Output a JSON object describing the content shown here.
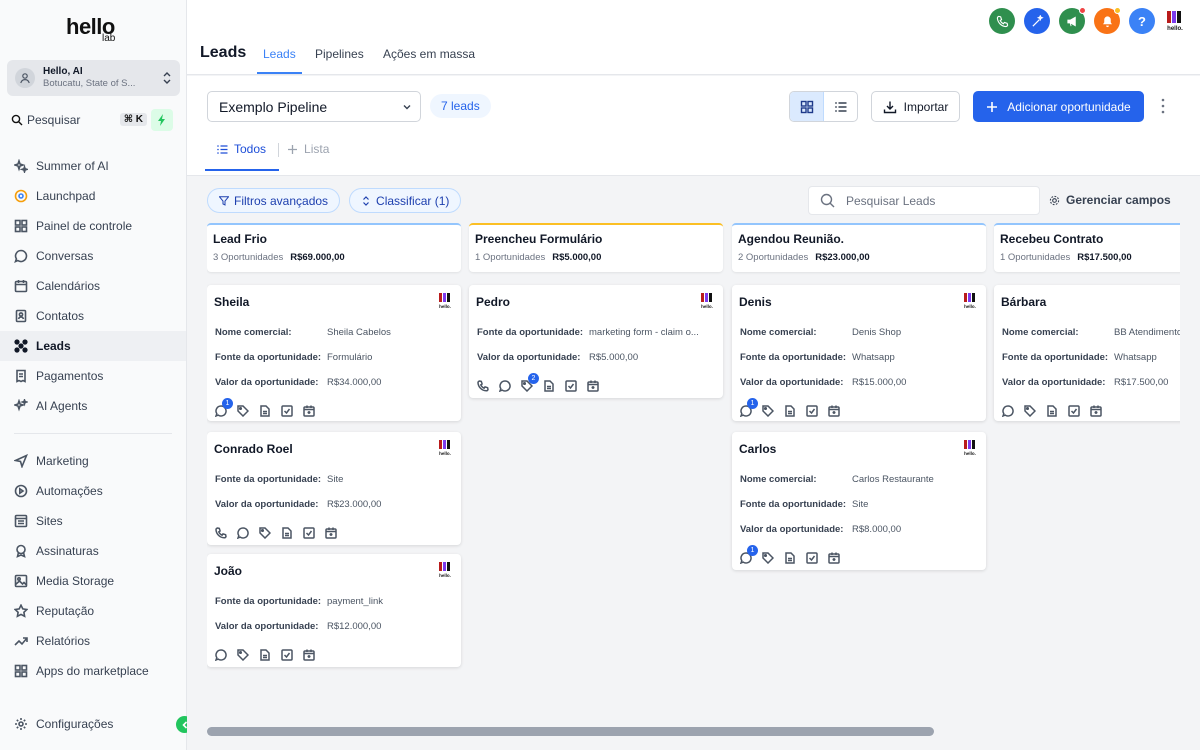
{
  "sidebar": {
    "logo": {
      "word": "hello",
      "sub": "lab"
    },
    "account": {
      "name": "Hello, AI",
      "location": "Botucatu, State of S..."
    },
    "search": {
      "label": "Pesquisar",
      "shortcut": "⌘ K"
    },
    "items": [
      {
        "label": "Summer of AI"
      },
      {
        "label": "Launchpad"
      },
      {
        "label": "Painel de controle"
      },
      {
        "label": "Conversas"
      },
      {
        "label": "Calendários"
      },
      {
        "label": "Contatos"
      },
      {
        "label": "Leads"
      },
      {
        "label": "Pagamentos"
      },
      {
        "label": "AI Agents"
      }
    ],
    "items2": [
      {
        "label": "Marketing"
      },
      {
        "label": "Automações"
      },
      {
        "label": "Sites"
      },
      {
        "label": "Assinaturas"
      },
      {
        "label": "Media Storage"
      },
      {
        "label": "Reputação"
      },
      {
        "label": "Relatórios"
      },
      {
        "label": "Apps do marketplace"
      }
    ],
    "settings": {
      "label": "Configurações"
    }
  },
  "header": {
    "title": "Leads",
    "tabs": [
      {
        "label": "Leads"
      },
      {
        "label": "Pipelines"
      },
      {
        "label": "Ações em massa"
      }
    ],
    "icon_colors": {
      "phone": "#2f8f4e",
      "magic": "#2563eb",
      "announce": "#2f8f4e",
      "bell": "#f97316",
      "help": "#3b82f6"
    }
  },
  "toolbar": {
    "pipeline": "Exemplo Pipeline",
    "leads_count": "7 leads",
    "import_label": "Importar",
    "add_label": "Adicionar oportunidade",
    "subtabs": [
      {
        "label": "Todos"
      },
      {
        "label": "Lista"
      }
    ],
    "filters_label": "Filtros avançados",
    "sort_label": "Classificar (1)",
    "search_placeholder": "Pesquisar Leads",
    "manage_label": "Gerenciar campos"
  },
  "columns": [
    {
      "name": "Lead Frio",
      "count": "3 Oportunidades",
      "total": "R$69.000,00",
      "cards": [
        {
          "name": "Sheila",
          "fields": [
            {
              "k": "Nome comercial:",
              "v": "Sheila Cabelos"
            },
            {
              "k": "Fonte da oportunidade:",
              "v": "Formulário"
            },
            {
              "k": "Valor da oportunidade:",
              "v": "R$34.000,00"
            }
          ]
        },
        {
          "name": "Conrado Roel",
          "fields": [
            {
              "k": "Fonte da oportunidade:",
              "v": "Site"
            },
            {
              "k": "Valor da oportunidade:",
              "v": "R$23.000,00"
            }
          ]
        },
        {
          "name": "João",
          "fields": [
            {
              "k": "Fonte da oportunidade:",
              "v": "payment_link"
            },
            {
              "k": "Valor da oportunidade:",
              "v": "R$12.000,00"
            }
          ]
        }
      ]
    },
    {
      "name": "Preencheu Formulário",
      "count": "1 Oportunidades",
      "total": "R$5.000,00",
      "cards": [
        {
          "name": "Pedro",
          "fields": [
            {
              "k": "Fonte da oportunidade:",
              "v": "marketing form - claim o..."
            },
            {
              "k": "Valor da oportunidade:",
              "v": "R$5.000,00"
            }
          ],
          "badge": "2"
        }
      ]
    },
    {
      "name": "Agendou Reunião.",
      "count": "2 Oportunidades",
      "total": "R$23.000,00",
      "cards": [
        {
          "name": "Denis",
          "fields": [
            {
              "k": "Nome comercial:",
              "v": "Denis Shop"
            },
            {
              "k": "Fonte da oportunidade:",
              "v": "Whatsapp"
            },
            {
              "k": "Valor da oportunidade:",
              "v": "R$15.000,00"
            }
          ],
          "badge": "1"
        },
        {
          "name": "Carlos",
          "fields": [
            {
              "k": "Nome comercial:",
              "v": "Carlos Restaurante"
            },
            {
              "k": "Fonte da oportunidade:",
              "v": "Site"
            },
            {
              "k": "Valor da oportunidade:",
              "v": "R$8.000,00"
            }
          ],
          "badge": "1"
        }
      ]
    },
    {
      "name": "Recebeu Contrato",
      "count": "1 Oportunidades",
      "total": "R$17.500,00",
      "cards": [
        {
          "name": "Bárbara",
          "fields": [
            {
              "k": "Nome comercial:",
              "v": "BB Atendimentos"
            },
            {
              "k": "Fonte da oportunidade:",
              "v": "Whatsapp"
            },
            {
              "k": "Valor da oportunidade:",
              "v": "R$17.500,00"
            }
          ]
        }
      ]
    }
  ],
  "badges": {
    "sheila": "1"
  }
}
